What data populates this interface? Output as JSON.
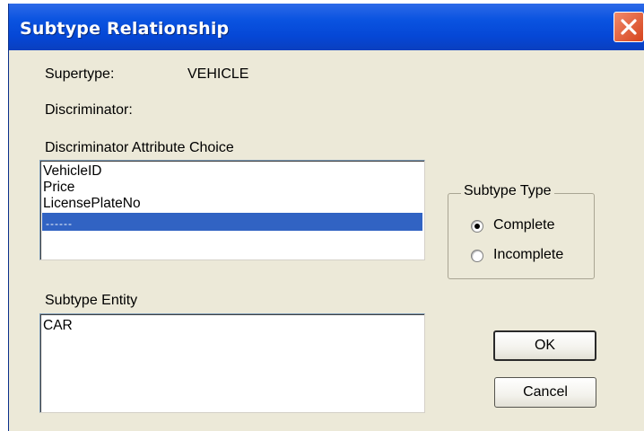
{
  "window": {
    "title": "Subtype Relationship"
  },
  "supertype": {
    "label": "Supertype:",
    "value": "VEHICLE"
  },
  "discriminator": {
    "label": "Discriminator:"
  },
  "attribute_choice": {
    "label": "Discriminator Attribute Choice",
    "items": [
      "VehicleID",
      "Price",
      "LicensePlateNo"
    ],
    "selected_item": "------"
  },
  "subtype_entity": {
    "label": "Subtype Entity",
    "items": [
      "CAR"
    ]
  },
  "subtype_type": {
    "legend": "Subtype Type",
    "options": [
      "Complete",
      "Incomplete"
    ],
    "selected": "Complete"
  },
  "buttons": {
    "ok": "OK",
    "cancel": "Cancel"
  },
  "colors": {
    "titlebar": "#0a53e0",
    "selection": "#3163c3",
    "close": "#d6431c",
    "dialog_bg": "#ece9d8"
  },
  "icons": {
    "close": "close-icon",
    "radio_selected": "radio-selected-icon",
    "radio_empty": "radio-empty-icon"
  }
}
